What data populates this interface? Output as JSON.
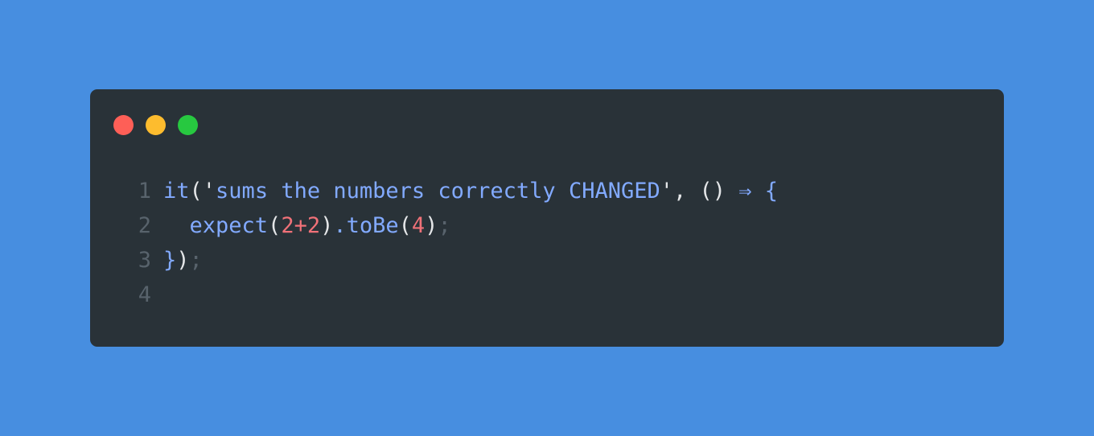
{
  "window": {
    "controls": {
      "close": "close-dot",
      "minimize": "minimize-dot",
      "zoom": "zoom-dot"
    }
  },
  "code": {
    "lines": [
      {
        "number": "1",
        "tokens": [
          {
            "text": "it",
            "kind": "fn"
          },
          {
            "text": "(",
            "kind": "punc"
          },
          {
            "text": "'",
            "kind": "punc"
          },
          {
            "text": "sums the numbers correctly CHANGED",
            "kind": "str"
          },
          {
            "text": "'",
            "kind": "punc"
          },
          {
            "text": ", () ",
            "kind": "punc"
          },
          {
            "text": "⇒",
            "kind": "op"
          },
          {
            "text": " {",
            "kind": "fn"
          }
        ]
      },
      {
        "number": "2",
        "tokens": [
          {
            "text": "  expect",
            "kind": "fn"
          },
          {
            "text": "(",
            "kind": "punc"
          },
          {
            "text": "2+2",
            "kind": "num"
          },
          {
            "text": ")",
            "kind": "punc"
          },
          {
            "text": ".toBe",
            "kind": "fn"
          },
          {
            "text": "(",
            "kind": "punc"
          },
          {
            "text": "4",
            "kind": "num"
          },
          {
            "text": ")",
            "kind": "punc"
          },
          {
            "text": ";",
            "kind": "muted"
          }
        ]
      },
      {
        "number": "3",
        "tokens": [
          {
            "text": "}",
            "kind": "fn"
          },
          {
            "text": ")",
            "kind": "punc"
          },
          {
            "text": ";",
            "kind": "muted"
          }
        ]
      },
      {
        "number": "4",
        "tokens": []
      }
    ]
  },
  "colors": {
    "background": "#478ee0",
    "editor": "#293238",
    "close": "#fe5f57",
    "minimize": "#fdbc2e",
    "zoom": "#27c840"
  }
}
